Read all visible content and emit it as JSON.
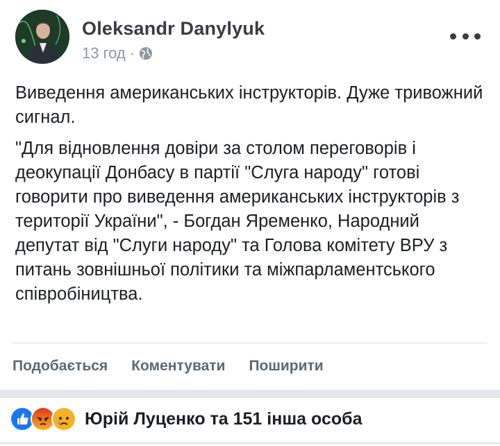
{
  "post": {
    "author": "Oleksandr Danylyuk",
    "time": "13 год",
    "separator": "·",
    "privacy_icon": "globe-icon",
    "paragraphs": [
      "Виведення американських інструкторів. Дуже тривожний сигнал.",
      "\"Для відновлення довіри за столом переговорів і деокупації Донбасу в партії \"Слуга народу\" готові говорити про виведення американських інструкторів з території України\", - Богдан Яременко, Народний депутат від \"Слуги народу\" та Голова комітету ВРУ з питань зовнішньої політики та міжпарламентського співробіництва."
    ]
  },
  "actions": {
    "like": "Подобається",
    "comment": "Коментувати",
    "share": "Поширити"
  },
  "reactions": {
    "icons": [
      "like-icon",
      "angry-icon",
      "sad-icon"
    ],
    "text": "Юрій Луценко та 151 інша особа"
  },
  "colors": {
    "like": "#1877f2",
    "angry": "#e9710f",
    "sad": "#f7b125",
    "secondary_text": "#606770"
  }
}
